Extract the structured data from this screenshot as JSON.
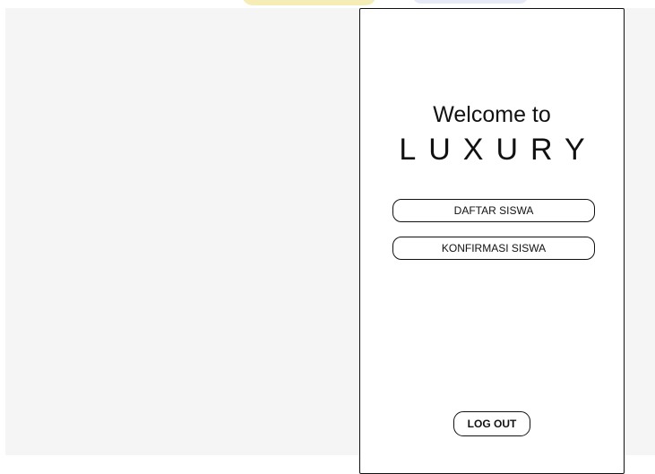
{
  "screen": {
    "welcome_text": "Welcome to",
    "brand_name": "LUXURY"
  },
  "menu": {
    "daftar_siswa_label": "DAFTAR SISWA",
    "konfirmasi_siswa_label": "KONFIRMASI SISWA"
  },
  "footer": {
    "logout_label": "LOG OUT"
  },
  "colors": {
    "background": "#f5f5f5",
    "frame": "#ffffff",
    "border": "#111111"
  }
}
